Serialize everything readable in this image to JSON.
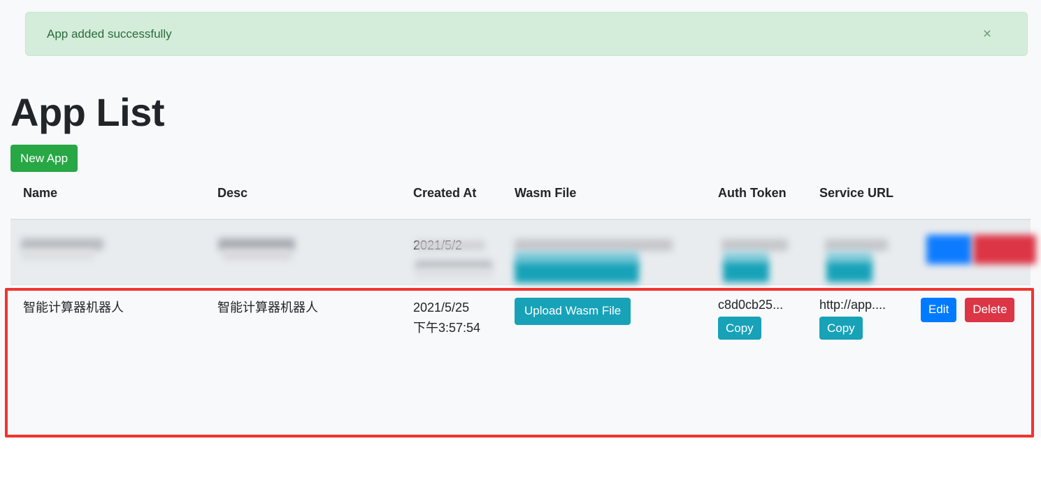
{
  "alert": {
    "message": "App added successfully",
    "close_label": "×",
    "bg_color": "#d4edda",
    "text_color": "#155724"
  },
  "page": {
    "title": "App List",
    "background_color": "#f8f9fa"
  },
  "toolbar": {
    "new_app_label": "New App",
    "new_app_color": "#28a745"
  },
  "table": {
    "headers": [
      "Name",
      "Desc",
      "Created At",
      "Wasm File",
      "Auth Token",
      "Service URL",
      ""
    ],
    "rows": [
      {
        "redacted": true,
        "name": "",
        "desc": "",
        "created_at_date": "2021/5/2",
        "created_at_time": "",
        "wasm_label": "",
        "auth_token": "",
        "auth_copy_label": "",
        "service_url": "",
        "url_copy_label": "",
        "edit_label": "",
        "delete_label": ""
      },
      {
        "redacted": false,
        "name": "智能计算器机器人",
        "desc": "智能计算器机器人",
        "created_at_date": "2021/5/25",
        "created_at_time": "下午3:57:54",
        "wasm_label": "Upload Wasm File",
        "auth_token": "c8d0cb25...",
        "auth_copy_label": "Copy",
        "service_url": "http://app....",
        "url_copy_label": "Copy",
        "edit_label": "Edit",
        "delete_label": "Delete"
      }
    ]
  },
  "annotation": {
    "highlight_color": "#f0342f"
  },
  "colors": {
    "info": "#17a2b8",
    "primary": "#007bff",
    "danger": "#dc3545",
    "success": "#28a745"
  }
}
